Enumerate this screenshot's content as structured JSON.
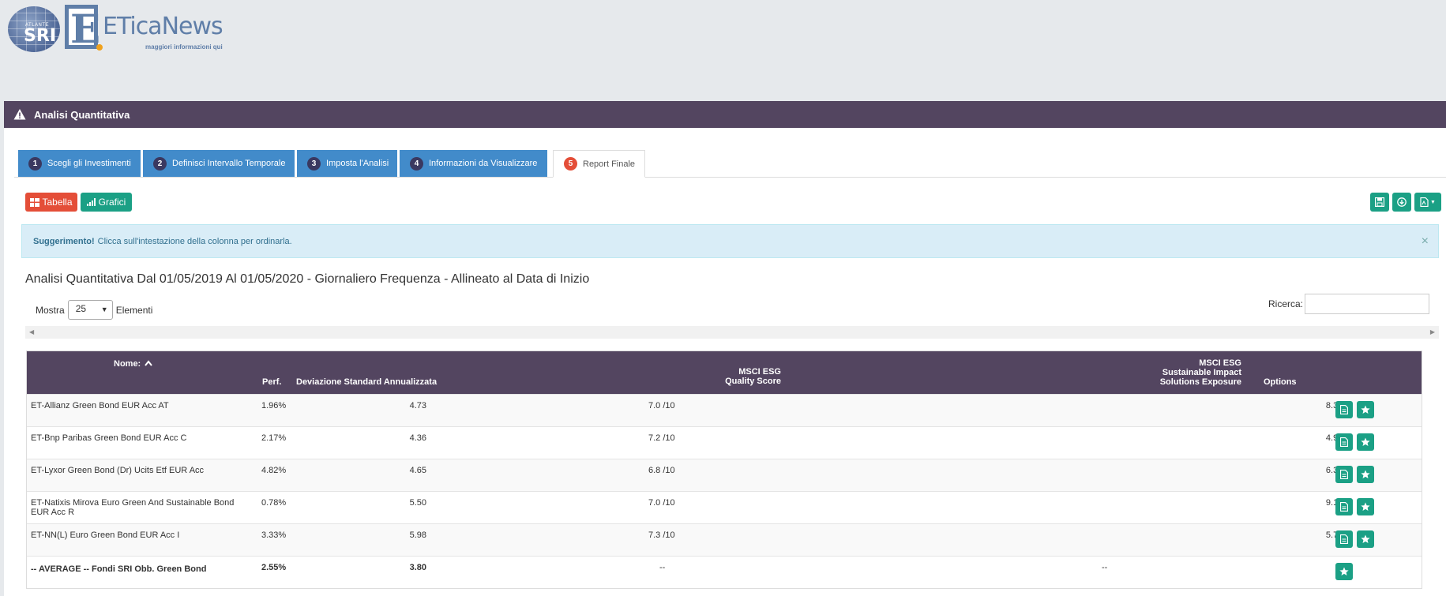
{
  "brand": {
    "globe_top": "ATLANTE",
    "globe_main": "SRI",
    "et_letter": "E",
    "name": "ETicaNews",
    "tagline": "maggiori informazioni qui"
  },
  "panel": {
    "title": "Analisi Quantitativa"
  },
  "tabs": [
    {
      "num": "1",
      "label": "Scegli gli Investimenti"
    },
    {
      "num": "2",
      "label": "Definisci Intervallo Temporale"
    },
    {
      "num": "3",
      "label": "Imposta l'Analisi"
    },
    {
      "num": "4",
      "label": "Informazioni da Visualizzare"
    },
    {
      "num": "5",
      "label": "Report Finale"
    }
  ],
  "toolbar": {
    "tabella": "Tabella",
    "grafici": "Grafici"
  },
  "alert": {
    "strong": "Suggerimento!",
    "text": "Clicca sull'intestazione della colonna per ordinarla.",
    "close": "×"
  },
  "report_title": "Analisi Quantitativa Dal 01/05/2019 Al 01/05/2020 - Giornaliero Frequenza - Allineato al Data di Inizio",
  "length": {
    "before": "Mostra",
    "value": "25",
    "after": "Elementi"
  },
  "search": {
    "label": "Ricerca:"
  },
  "columns": {
    "nome": "Nome:",
    "perf": "Perf.",
    "dev": "Deviazione Standard Annualizzata",
    "msci_q1": "MSCI ESG",
    "msci_q2": "Quality Score",
    "msci_s1": "MSCI ESG",
    "msci_s2": "Sustainable Impact",
    "msci_s3": "Solutions Exposure",
    "options": "Options"
  },
  "rows": [
    {
      "name": "ET-Allianz Green Bond EUR Acc AT",
      "name2": "",
      "perf": "1.96%",
      "dev": "4.73",
      "quality": "7.0 /10",
      "impact": "8.3%"
    },
    {
      "name": "ET-Bnp Paribas Green Bond EUR Acc C",
      "name2": "",
      "perf": "2.17%",
      "dev": "4.36",
      "quality": "7.2 /10",
      "impact": "4.9%"
    },
    {
      "name": "ET-Lyxor Green Bond (Dr) Ucits Etf EUR Acc",
      "name2": "",
      "perf": "4.82%",
      "dev": "4.65",
      "quality": "6.8 /10",
      "impact": "6.3%"
    },
    {
      "name": "ET-Natixis Mirova Euro Green And Sustainable Bond",
      "name2": "EUR Acc R",
      "perf": "0.78%",
      "dev": "5.50",
      "quality": "7.0 /10",
      "impact": "9.1%"
    },
    {
      "name": "ET-NN(L) Euro Green Bond EUR Acc I",
      "name2": "",
      "perf": "3.33%",
      "dev": "5.98",
      "quality": "7.3 /10",
      "impact": "5.7%"
    }
  ],
  "average": {
    "name": "-- AVERAGE -- Fondi SRI Obb. Green Bond",
    "perf": "2.55%",
    "dev": "3.80",
    "quality": "--",
    "impact": "--"
  }
}
